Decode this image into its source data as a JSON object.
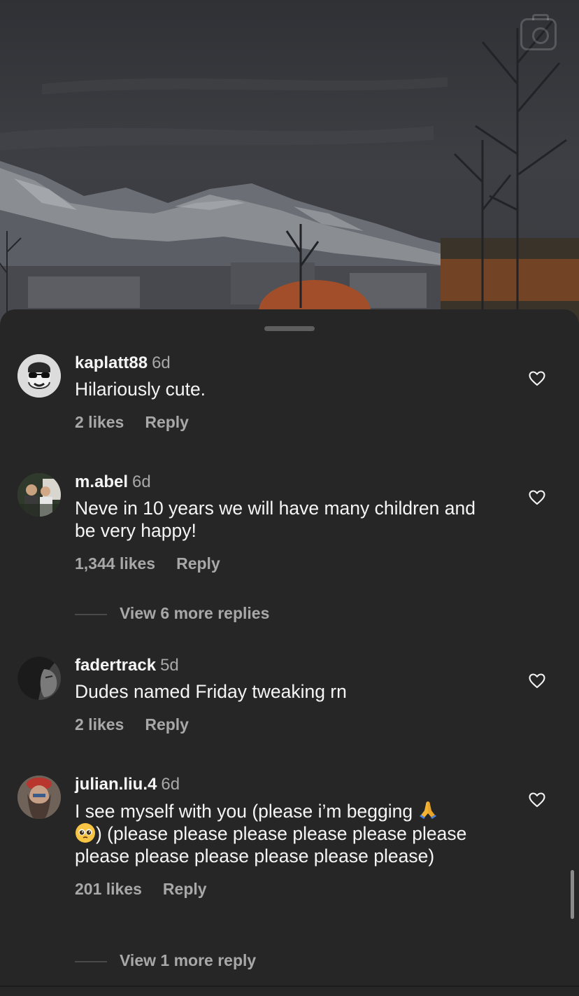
{
  "comments": [
    {
      "username": "kaplatt88",
      "time": "6d",
      "text": "Hilariously cute.",
      "likes": "2 likes",
      "reply": "Reply"
    },
    {
      "username": "m.abel",
      "time": "6d",
      "text": "Neve in 10 years we will have many children and be very happy!",
      "likes": "1,344 likes",
      "reply": "Reply",
      "view_more": "View 6 more replies"
    },
    {
      "username": "fadertrack",
      "time": "5d",
      "text": "Dudes named Friday tweaking rn",
      "likes": "2 likes",
      "reply": "Reply"
    },
    {
      "username": "julian.liu.4",
      "time": "6d",
      "text_part1": "I see myself with you (please i’m begging ",
      "text_part2": ") (please please please please please please please please please please please please)",
      "likes": "201 likes",
      "reply": "Reply",
      "view_more": "View 1 more reply"
    }
  ],
  "icons": {
    "camera": "camera-icon",
    "heart": "heart-outline-icon",
    "pray_emoji": "folded-hands-emoji",
    "plead_emoji": "pleading-face-emoji"
  },
  "colors": {
    "sheet_bg": "#262626",
    "primary_text": "#f5f5f5",
    "secondary_text": "#a8a8a8"
  }
}
